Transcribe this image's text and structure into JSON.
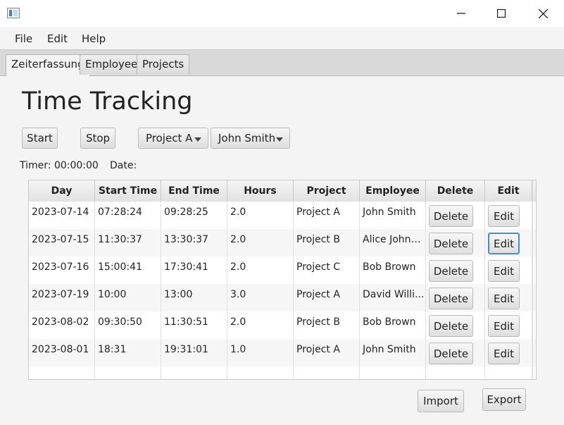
{
  "window": {
    "minimize_icon": "minimize-icon",
    "maximize_icon": "maximize-icon",
    "close_icon": "close-icon"
  },
  "menu": [
    "File",
    "Edit",
    "Help"
  ],
  "tabs": [
    "Zeiterfassung",
    "Employee",
    "Projects"
  ],
  "page_title": "Time Tracking",
  "toolbar": {
    "start": "Start",
    "stop": "Stop",
    "project_selected": "Project A",
    "employee_selected": "John Smith"
  },
  "info": {
    "timer": "Timer: 00:00:00",
    "date": "Date:"
  },
  "table": {
    "columns": [
      "Day",
      "Start Time",
      "End Time",
      "Hours",
      "Project",
      "Employee",
      "Delete",
      "Edit"
    ],
    "rows": [
      {
        "day": "2023-07-14",
        "start": "07:28:24",
        "end": "09:28:25",
        "hours": "2.0",
        "project": "Project A",
        "employee": "John Smith",
        "delete": "Delete",
        "edit": "Edit"
      },
      {
        "day": "2023-07-15",
        "start": "11:30:37",
        "end": "13:30:37",
        "hours": "2.0",
        "project": "Project B",
        "employee": "Alice Johns...",
        "delete": "Delete",
        "edit": "Edit"
      },
      {
        "day": "2023-07-16",
        "start": "15:00:41",
        "end": "17:30:41",
        "hours": "2.0",
        "project": "Project C",
        "employee": "Bob Brown",
        "delete": "Delete",
        "edit": "Edit"
      },
      {
        "day": "2023-07-19",
        "start": "10:00",
        "end": "13:00",
        "hours": "3.0",
        "project": "Project A",
        "employee": "David Willi...",
        "delete": "Delete",
        "edit": "Edit"
      },
      {
        "day": "2023-08-02",
        "start": "09:30:50",
        "end": "11:30:51",
        "hours": "2.0",
        "project": "Project B",
        "employee": "Bob Brown",
        "delete": "Delete",
        "edit": "Edit"
      },
      {
        "day": "2023-08-01",
        "start": "18:31",
        "end": "19:31:01",
        "hours": "1.0",
        "project": "Project A",
        "employee": "John Smith",
        "delete": "Delete",
        "edit": "Edit"
      }
    ]
  },
  "actions": {
    "import": "Import",
    "export": "Export"
  },
  "colors": {
    "focus": "#3d8fd8"
  }
}
